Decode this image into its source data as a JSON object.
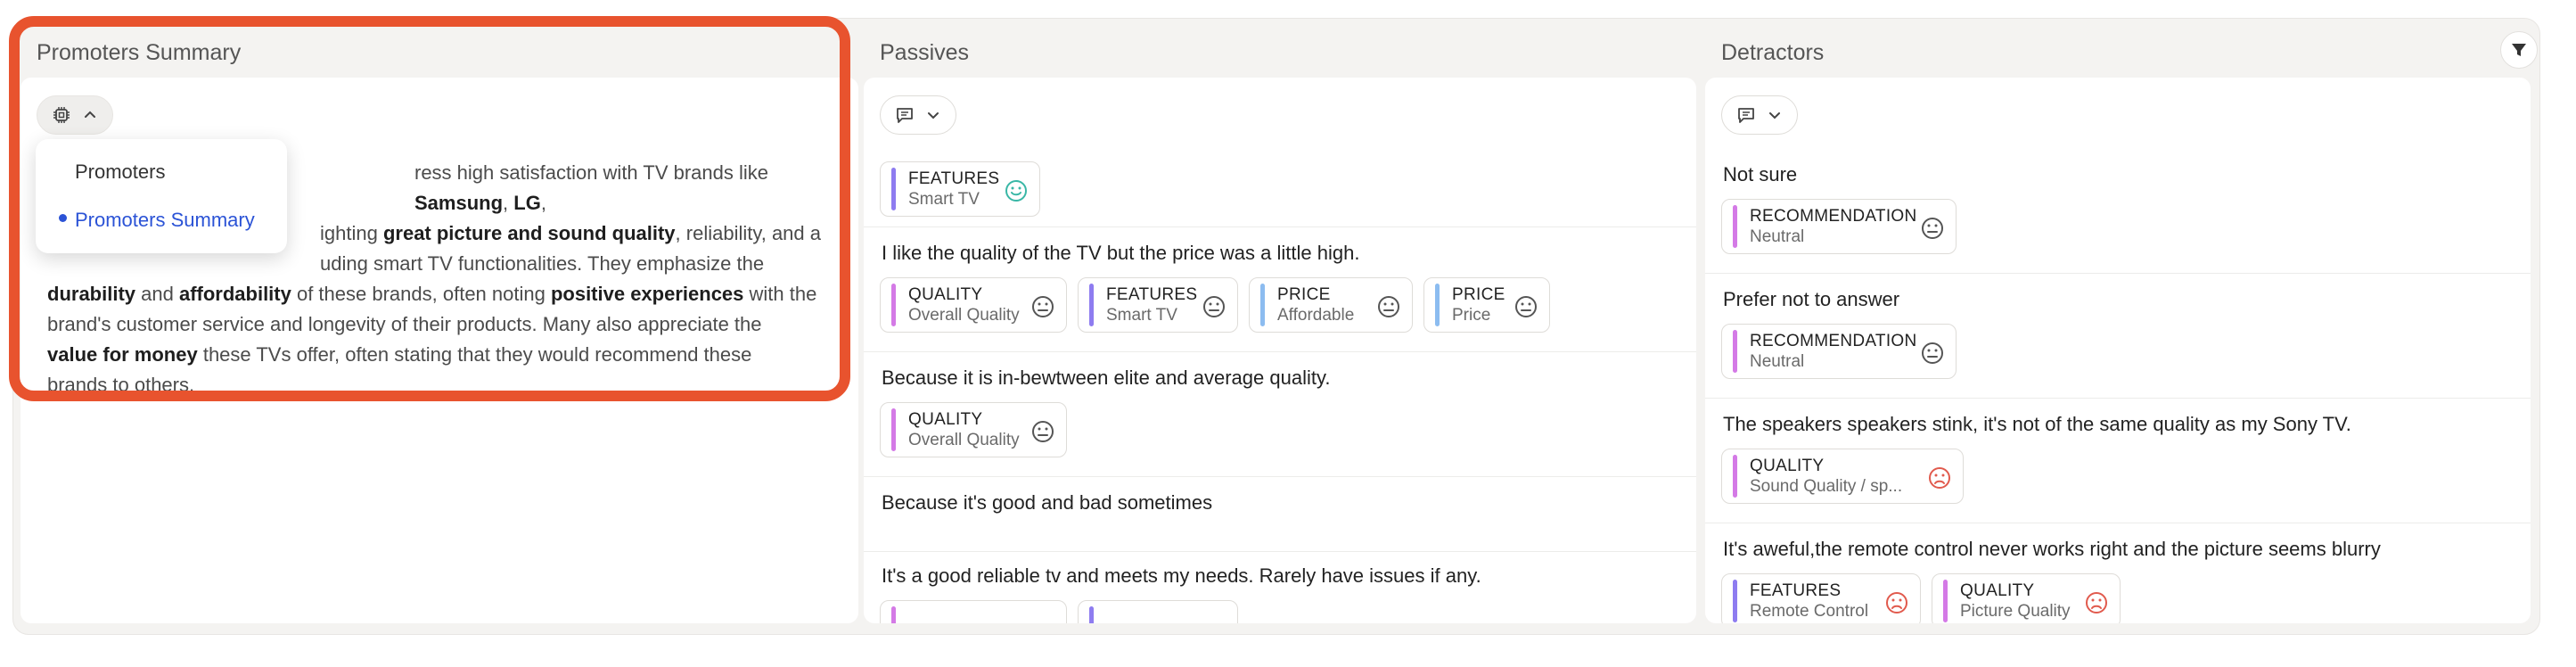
{
  "columns": {
    "promoters": {
      "title": "Promoters Summary",
      "dropdown": {
        "items": [
          {
            "label": "Promoters"
          },
          {
            "label": "Promoters Summary"
          }
        ]
      },
      "summary": {
        "l1a": "ress high satisfaction with TV brands like ",
        "l1b": "Samsung",
        "l1c": ", ",
        "l1d": "LG",
        "l1e": ",",
        "l2a": "ighting ",
        "l2b": "great picture and sound quality",
        "l2c": ", reliability, and a",
        "l3a": "uding smart TV functionalities. They emphasize the",
        "l4a": "durability",
        "l4b": " and ",
        "l4c": "affordability",
        "l4d": " of these brands, often noting ",
        "l4e": "positive experiences",
        "l4f": " with the",
        "l5a": "brand's customer service and longevity of their products. Many also appreciate the",
        "l6a": "value for money",
        "l6b": " these TVs offer, often stating that they would recommend these",
        "l7a": "brands to others."
      }
    },
    "passives": {
      "title": "Passives",
      "rows": [
        {
          "text": "",
          "tags": [
            {
              "category": "FEATURES",
              "sub": "Smart TV",
              "sentiment": "positive"
            }
          ]
        },
        {
          "text": "I like the quality of the TV but the price was a little high.",
          "tags": [
            {
              "category": "QUALITY",
              "sub": "Overall Quality",
              "sentiment": "neutral"
            },
            {
              "category": "FEATURES",
              "sub": "Smart TV",
              "sentiment": "neutral"
            },
            {
              "category": "PRICE",
              "sub": "Affordable",
              "sentiment": "neutral"
            },
            {
              "category": "PRICE",
              "sub": "Price",
              "sentiment": "neutral"
            }
          ]
        },
        {
          "text": "Because it is in-bewtween elite and average quality.",
          "tags": [
            {
              "category": "QUALITY",
              "sub": "Overall Quality",
              "sentiment": "neutral"
            }
          ]
        },
        {
          "text": "Because it's good and bad sometimes",
          "tags": []
        },
        {
          "text": "It's a good reliable tv and meets my needs. Rarely have issues if any.",
          "tags": []
        }
      ]
    },
    "detractors": {
      "title": "Detractors",
      "rows": [
        {
          "text": "Not sure",
          "tags": [
            {
              "category": "RECOMMENDATION",
              "sub": "Neutral",
              "sentiment": "neutral"
            }
          ]
        },
        {
          "text": "Prefer not to answer",
          "tags": [
            {
              "category": "RECOMMENDATION",
              "sub": "Neutral",
              "sentiment": "neutral"
            }
          ]
        },
        {
          "text": "The speakers speakers stink, it's not of the same quality as my Sony TV.",
          "tags": [
            {
              "category": "QUALITY",
              "sub": "Sound Quality / sp...",
              "sentiment": "negative"
            }
          ]
        },
        {
          "text": "It's aweful,the remote control never works right and the picture seems blurry",
          "tags": [
            {
              "category": "FEATURES",
              "sub": "Remote Control",
              "sentiment": "negative"
            },
            {
              "category": "QUALITY",
              "sub": "Picture Quality",
              "sentiment": "negative"
            }
          ]
        }
      ]
    }
  },
  "icons": {
    "ai_chip": "chip-icon",
    "comment": "comment-icon",
    "chevron_up": "chevron-up-icon",
    "chevron_down": "chevron-down-icon",
    "filter": "filter-icon",
    "smiley": "smiley-face-icon",
    "neutral": "neutral-face-icon",
    "frown": "frown-face-icon"
  },
  "colors": {
    "highlight_border": "#e8532e",
    "active_menu": "#2b53d6",
    "positive_face": "#39b7a6",
    "negative_face": "#e15a4d",
    "neutral_face": "#555555",
    "quality_bar": "#d47ae6",
    "features_bar": "#8e7cf0",
    "price_bar": "#8cbcf0",
    "recommendation_bar": "#d47ae6"
  }
}
